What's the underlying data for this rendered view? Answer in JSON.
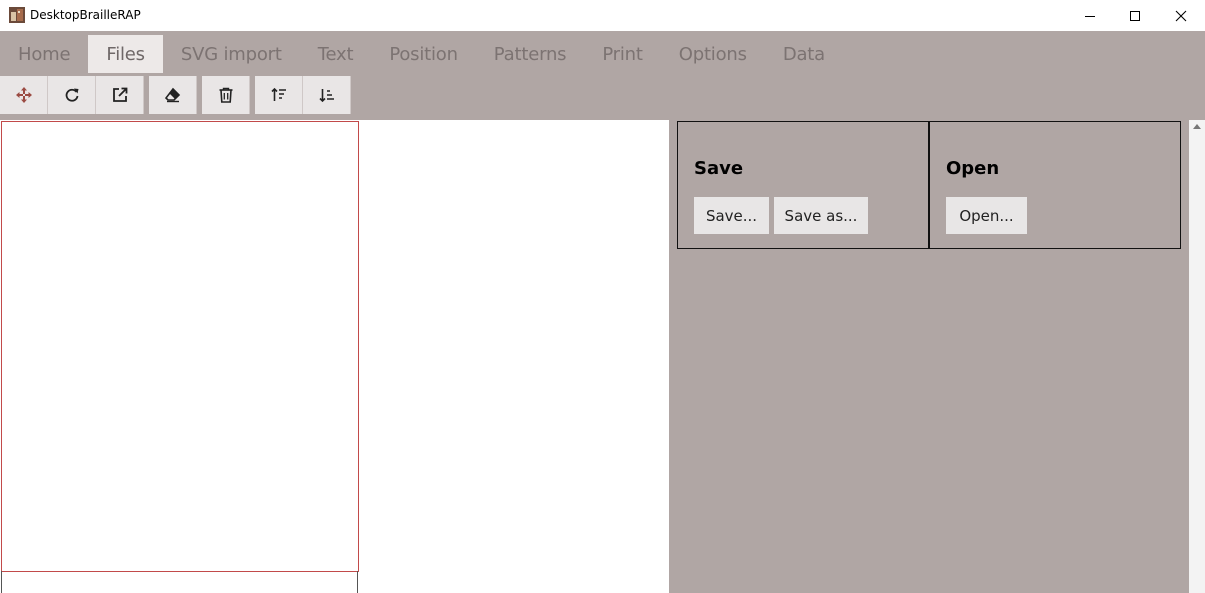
{
  "window": {
    "title": "DesktopBrailleRAP"
  },
  "menu": {
    "tabs": [
      {
        "label": "Home"
      },
      {
        "label": "Files"
      },
      {
        "label": "SVG import"
      },
      {
        "label": "Text"
      },
      {
        "label": "Position"
      },
      {
        "label": "Patterns"
      },
      {
        "label": "Print"
      },
      {
        "label": "Options"
      },
      {
        "label": "Data"
      }
    ],
    "active_tab": "Files"
  },
  "toolbar": {
    "icons": [
      "move-icon",
      "rotate-icon",
      "external-link-icon",
      "eraser-icon",
      "trash-icon",
      "sort-up-icon",
      "sort-down-icon"
    ]
  },
  "panel": {
    "save_group": {
      "title": "Save",
      "save_button": "Save...",
      "save_as_button": "Save as..."
    },
    "open_group": {
      "title": "Open",
      "open_button": "Open..."
    }
  },
  "colors": {
    "ribbon_bg": "#b0a6a4",
    "tab_active_bg": "#ede9e8",
    "page_border": "#c24a4a",
    "move_icon": "#9b4b43"
  }
}
